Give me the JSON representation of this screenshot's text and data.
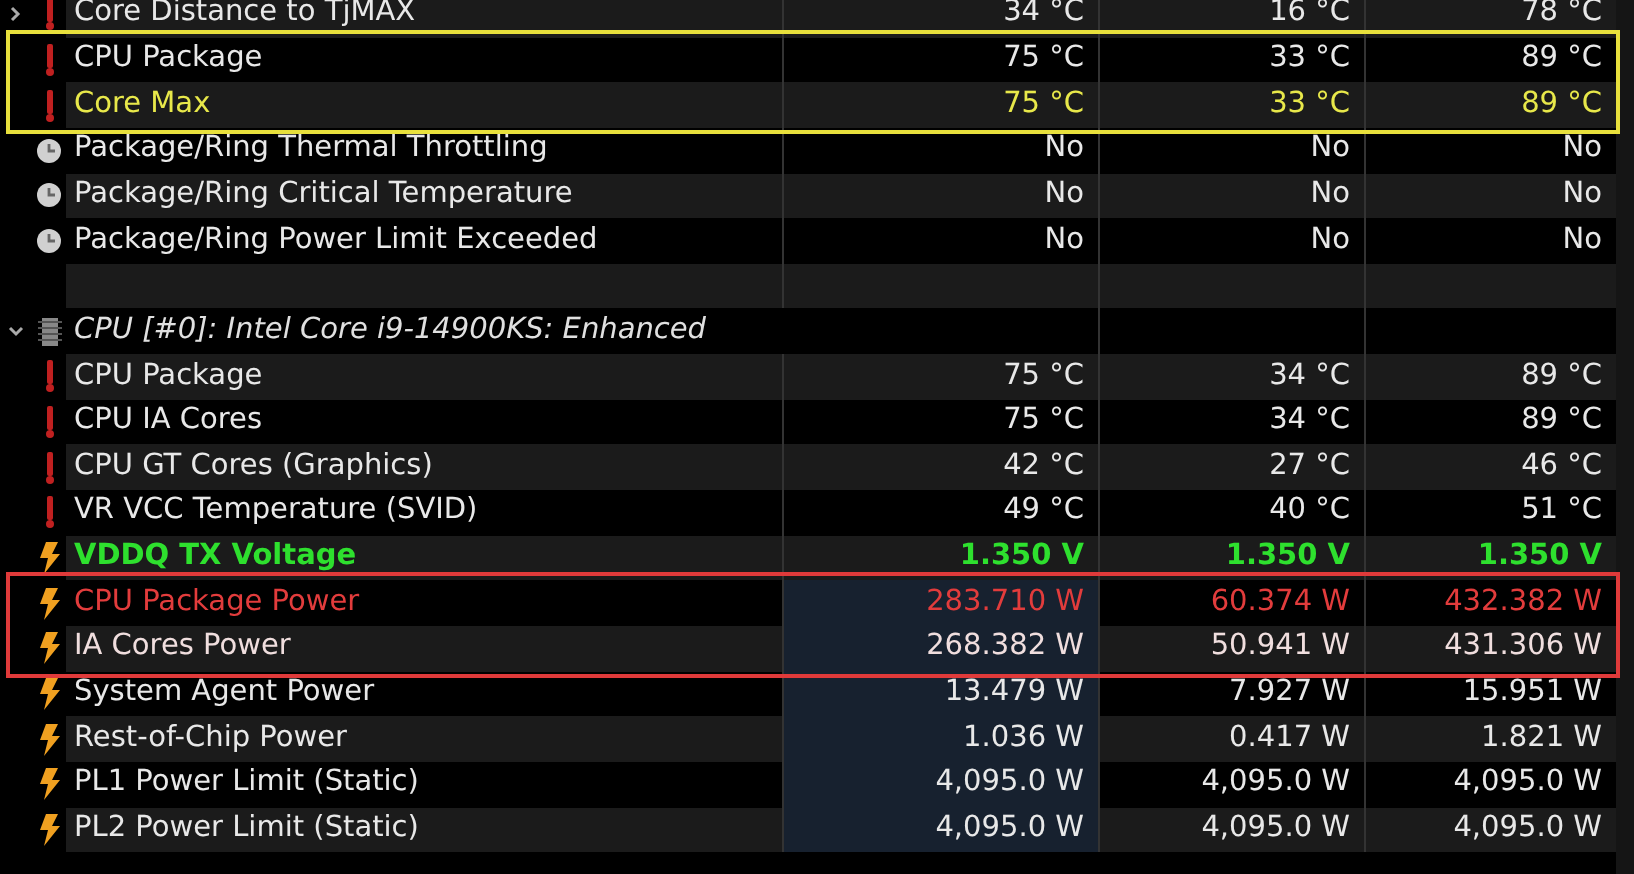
{
  "rows": [
    {
      "kind": "temperature",
      "name": "Core Distance to TjMAX",
      "values": [
        "34 °C",
        "16 °C",
        "78 °C"
      ],
      "color": "#e8e8e8",
      "expanded": false
    },
    {
      "kind": "outlined",
      "color": "#e8e03c",
      "rows": [
        {
          "kind": "temperature",
          "name": "CPU Package",
          "values": [
            "75 °C",
            "33 °C",
            "89 °C"
          ],
          "color": "#e8e8e8"
        },
        {
          "kind": "temperature",
          "name": "Core Max",
          "values": [
            "75 °C",
            "33 °C",
            "89 °C"
          ],
          "color": "#e8e84a"
        }
      ]
    },
    {
      "kind": "status",
      "name": "Package/Ring Thermal Throttling",
      "values": [
        "No",
        "No",
        "No"
      ],
      "color": "#e8e8e8"
    },
    {
      "kind": "status",
      "name": "Package/Ring Critical Temperature",
      "values": [
        "No",
        "No",
        "No"
      ],
      "color": "#e8e8e8"
    },
    {
      "kind": "status",
      "name": "Package/Ring Power Limit Exceeded",
      "values": [
        "No",
        "No",
        "No"
      ],
      "color": "#e8e8e8"
    },
    {
      "kind": "blank"
    },
    {
      "kind": "section",
      "name": "CPU [#0]: Intel Core i9-14900KS: Enhanced",
      "expanded": true
    },
    {
      "kind": "temperature",
      "name": "CPU Package",
      "values": [
        "75 °C",
        "34 °C",
        "89 °C"
      ],
      "color": "#e8e8e8"
    },
    {
      "kind": "temperature",
      "name": "CPU IA Cores",
      "values": [
        "75 °C",
        "34 °C",
        "89 °C"
      ],
      "color": "#e8e8e8"
    },
    {
      "kind": "temperature",
      "name": "CPU GT Cores (Graphics)",
      "values": [
        "42 °C",
        "27 °C",
        "46 °C"
      ],
      "color": "#e8e8e8"
    },
    {
      "kind": "temperature",
      "name": "VR VCC Temperature (SVID)",
      "values": [
        "49 °C",
        "40 °C",
        "51 °C"
      ],
      "color": "#e8e8e8"
    },
    {
      "kind": "power",
      "name": "VDDQ TX Voltage",
      "values": [
        "1.350 V",
        "1.350 V",
        "1.350 V"
      ],
      "color": "#2ee02e",
      "bold": true
    },
    {
      "kind": "outlined",
      "color": "#e03a3a",
      "rows": [
        {
          "kind": "power",
          "name": "CPU Package Power",
          "values": [
            "283.710 W",
            "60.374 W",
            "432.382 W"
          ],
          "color": "#e23c3c",
          "highlighted": true
        },
        {
          "kind": "power",
          "name": "IA Cores Power",
          "values": [
            "268.382 W",
            "50.941 W",
            "431.306 W"
          ],
          "color": "#f0dede",
          "highlighted": true
        }
      ]
    },
    {
      "kind": "power",
      "name": "System Agent Power",
      "values": [
        "13.479 W",
        "7.927 W",
        "15.951 W"
      ],
      "color": "#e8e8e8",
      "highlighted": true
    },
    {
      "kind": "power",
      "name": "Rest-of-Chip Power",
      "values": [
        "1.036 W",
        "0.417 W",
        "1.821 W"
      ],
      "color": "#e8e8e8",
      "highlighted": true
    },
    {
      "kind": "power",
      "name": "PL1 Power Limit (Static)",
      "values": [
        "4,095.0 W",
        "4,095.0 W",
        "4,095.0 W"
      ],
      "color": "#e8e8e8",
      "highlighted": true
    },
    {
      "kind": "power",
      "name": "PL2 Power Limit (Static)",
      "values": [
        "4,095.0 W",
        "4,095.0 W",
        "4,095.0 W"
      ],
      "color": "#e8e8e8",
      "highlighted": true
    }
  ]
}
